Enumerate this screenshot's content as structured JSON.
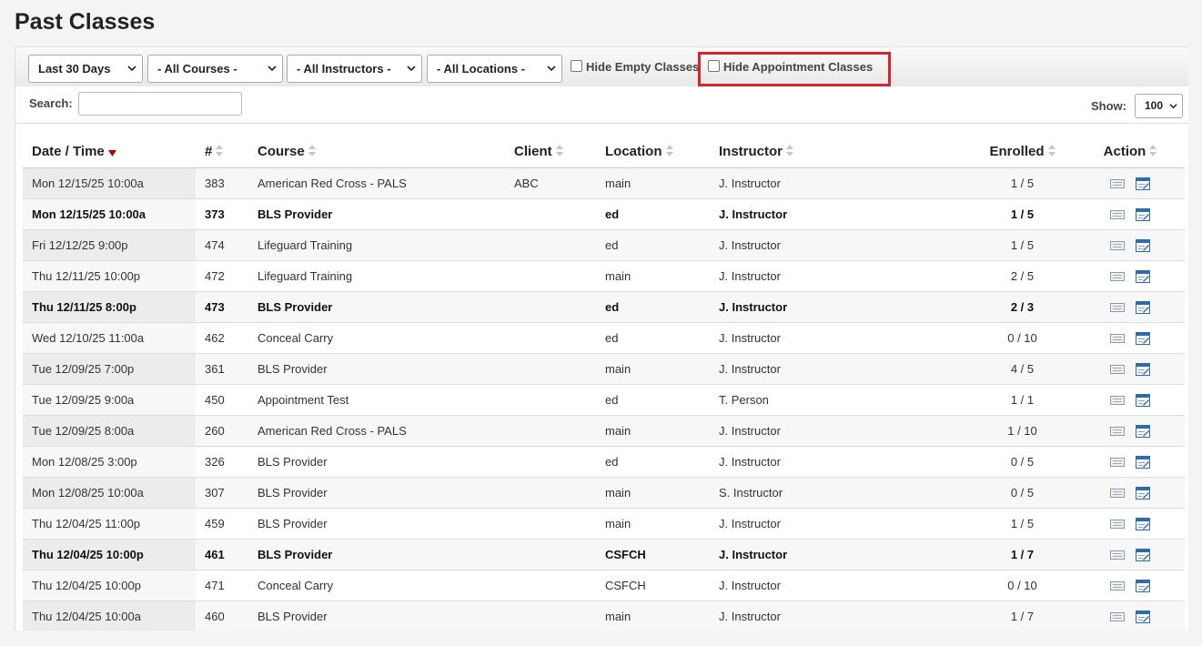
{
  "page": {
    "title": "Past Classes"
  },
  "filters": {
    "date_range": "Last 30 Days",
    "courses": "- All Courses -",
    "instructors": "- All Instructors -",
    "locations": "- All Locations -",
    "hide_empty_label": "Hide Empty Classes",
    "hide_empty_checked": false,
    "hide_appointment_label": "Hide Appointment Classes",
    "hide_appointment_checked": false
  },
  "search": {
    "label": "Search:",
    "value": ""
  },
  "show": {
    "label": "Show:",
    "value": "100"
  },
  "table": {
    "columns": [
      "Date / Time",
      "#",
      "Course",
      "Client",
      "Location",
      "Instructor",
      "Enrolled",
      "Action"
    ],
    "sorted_column": "Date / Time",
    "sort_direction": "desc",
    "rows": [
      {
        "date": "Mon 12/15/25 10:00a",
        "num": "383",
        "course": "American Red Cross - PALS",
        "client": "ABC",
        "location": "main",
        "instructor": "J. Instructor",
        "enrolled": "1 / 5",
        "bold": false
      },
      {
        "date": "Mon 12/15/25 10:00a",
        "num": "373",
        "course": "BLS Provider",
        "client": "",
        "location": "ed",
        "instructor": "J. Instructor",
        "enrolled": "1 / 5",
        "bold": true
      },
      {
        "date": "Fri 12/12/25 9:00p",
        "num": "474",
        "course": "Lifeguard Training",
        "client": "",
        "location": "ed",
        "instructor": "J. Instructor",
        "enrolled": "1 / 5",
        "bold": false
      },
      {
        "date": "Thu 12/11/25 10:00p",
        "num": "472",
        "course": "Lifeguard Training",
        "client": "",
        "location": "main",
        "instructor": "J. Instructor",
        "enrolled": "2 / 5",
        "bold": false
      },
      {
        "date": "Thu 12/11/25 8:00p",
        "num": "473",
        "course": "BLS Provider",
        "client": "",
        "location": "ed",
        "instructor": "J. Instructor",
        "enrolled": "2 / 3",
        "bold": true
      },
      {
        "date": "Wed 12/10/25 11:00a",
        "num": "462",
        "course": "Conceal Carry",
        "client": "",
        "location": "ed",
        "instructor": "J. Instructor",
        "enrolled": "0 / 10",
        "bold": false
      },
      {
        "date": "Tue 12/09/25 7:00p",
        "num": "361",
        "course": "BLS Provider",
        "client": "",
        "location": "main",
        "instructor": "J. Instructor",
        "enrolled": "4 / 5",
        "bold": false
      },
      {
        "date": "Tue 12/09/25 9:00a",
        "num": "450",
        "course": "Appointment Test",
        "client": "",
        "location": "ed",
        "instructor": "T. Person",
        "enrolled": "1 / 1",
        "bold": false
      },
      {
        "date": "Tue 12/09/25 8:00a",
        "num": "260",
        "course": "American Red Cross - PALS",
        "client": "",
        "location": "main",
        "instructor": "J. Instructor",
        "enrolled": "1 / 10",
        "bold": false
      },
      {
        "date": "Mon 12/08/25 3:00p",
        "num": "326",
        "course": "BLS Provider",
        "client": "",
        "location": "ed",
        "instructor": "J. Instructor",
        "enrolled": "0 / 5",
        "bold": false
      },
      {
        "date": "Mon 12/08/25 10:00a",
        "num": "307",
        "course": "BLS Provider",
        "client": "",
        "location": "main",
        "instructor": "S. Instructor",
        "enrolled": "0 / 5",
        "bold": false
      },
      {
        "date": "Thu 12/04/25 11:00p",
        "num": "459",
        "course": "BLS Provider",
        "client": "",
        "location": "main",
        "instructor": "J. Instructor",
        "enrolled": "1 / 5",
        "bold": false
      },
      {
        "date": "Thu 12/04/25 10:00p",
        "num": "461",
        "course": "BLS Provider",
        "client": "",
        "location": "CSFCH",
        "instructor": "J. Instructor",
        "enrolled": "1 / 7",
        "bold": true
      },
      {
        "date": "Thu 12/04/25 10:00p",
        "num": "471",
        "course": "Conceal Carry",
        "client": "",
        "location": "CSFCH",
        "instructor": "J. Instructor",
        "enrolled": "0 / 10",
        "bold": false
      },
      {
        "date": "Thu 12/04/25 10:00a",
        "num": "460",
        "course": "BLS Provider",
        "client": "",
        "location": "main",
        "instructor": "J. Instructor",
        "enrolled": "1 / 7",
        "bold": false
      }
    ]
  },
  "icons": {
    "roster": "roster-icon",
    "edit": "edit-icon"
  },
  "colors": {
    "highlight": "#d9232d",
    "sort_active": "#b00000",
    "edit_icon": "#2a6db5"
  }
}
